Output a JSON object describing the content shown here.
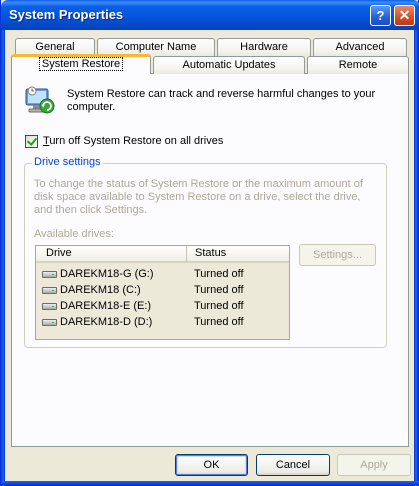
{
  "window": {
    "title": "System Properties"
  },
  "titlebar": {
    "help_glyph": "?",
    "close_glyph": "✕"
  },
  "tabs": {
    "row_top": [
      "General",
      "Computer Name",
      "Hardware",
      "Advanced"
    ],
    "row_bottom": [
      "System Restore",
      "Automatic Updates",
      "Remote"
    ],
    "active": "System Restore"
  },
  "info": {
    "text": "System Restore can track and reverse harmful changes to your computer."
  },
  "checkbox": {
    "label_accel": "T",
    "label_rest": "urn off System Restore on all drives",
    "checked": true
  },
  "drive_settings": {
    "title": "Drive settings",
    "description": "To change the status of System Restore or the maximum amount of disk space available to System Restore on a drive, select the drive, and then click Settings.",
    "available_label": "Available drives:",
    "columns": [
      "Drive",
      "Status"
    ],
    "rows": [
      {
        "drive": "DAREKM18-G (G:)",
        "status": "Turned off"
      },
      {
        "drive": "DAREKM18 (C:)",
        "status": "Turned off"
      },
      {
        "drive": "DAREKM18-E (E:)",
        "status": "Turned off"
      },
      {
        "drive": "DAREKM18-D (D:)",
        "status": "Turned off"
      }
    ],
    "settings_button": "Settings..."
  },
  "footer": {
    "ok": "OK",
    "cancel": "Cancel",
    "apply": "Apply"
  },
  "colors": {
    "titlebar": "#0553d9",
    "face": "#ece9d8",
    "group_title": "#0046d5",
    "disabled": "#aca899",
    "tab_highlight": "#f7b736"
  },
  "icons": [
    "help-icon",
    "close-icon",
    "system-restore-icon",
    "drive-icon"
  ]
}
